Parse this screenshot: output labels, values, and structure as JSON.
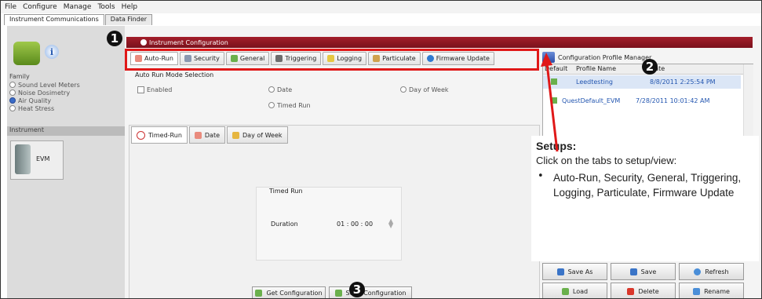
{
  "menu": [
    "File",
    "Configure",
    "Manage",
    "Tools",
    "Help"
  ],
  "app_tabs": [
    "Instrument Communications",
    "Data Finder"
  ],
  "left": {
    "family_label": "Family",
    "family_options": [
      "Sound Level Meters",
      "Noise Dosimetry",
      "Air Quality",
      "Heat Stress"
    ],
    "selected_family": "Air Quality",
    "instrument_label": "Instrument",
    "instrument_name": "EVM"
  },
  "panel": {
    "title": "Instrument Configuration",
    "tabs": [
      "Auto-Run",
      "Security",
      "General",
      "Triggering",
      "Logging",
      "Particulate",
      "Firmware Update"
    ],
    "auto_run_group": "Auto Run Mode Selection",
    "enabled_label": "Enabled",
    "date_label": "Date",
    "day_of_week_label": "Day of Week",
    "timed_run_label": "Timed Run",
    "inner_tabs": [
      "Timed-Run",
      "Date",
      "Day of Week"
    ],
    "timed_group": "Timed Run",
    "duration_label": "Duration",
    "duration_value": "01 : 00 : 00",
    "get_config_label": "Get Configuration",
    "send_config_label": "Send Configuration"
  },
  "profiles": {
    "title": "Configuration Profile Manager",
    "col_default": "Default",
    "col_name": "Profile Name",
    "col_date": "Date",
    "rows": [
      {
        "name": "Leedtesting",
        "date": "8/8/2011 2:25:54 PM"
      },
      {
        "name": "QuestDefault_EVM",
        "date": "7/28/2011 10:01:42 AM"
      }
    ],
    "buttons": [
      "Save As",
      "Save",
      "Refresh",
      "Load",
      "Delete",
      "Rename"
    ]
  },
  "callout": {
    "heading": "Setups:",
    "line1": "Click on the tabs to setup/view:",
    "bullet": "Auto-Run, Security, General, Triggering, Logging, Particulate, Firmware Update"
  },
  "markers": [
    "1",
    "2",
    "3"
  ],
  "colors": {
    "title_bar": "#8e1622",
    "highlight": "#e01818",
    "selected_row": "#dbe6f6"
  }
}
